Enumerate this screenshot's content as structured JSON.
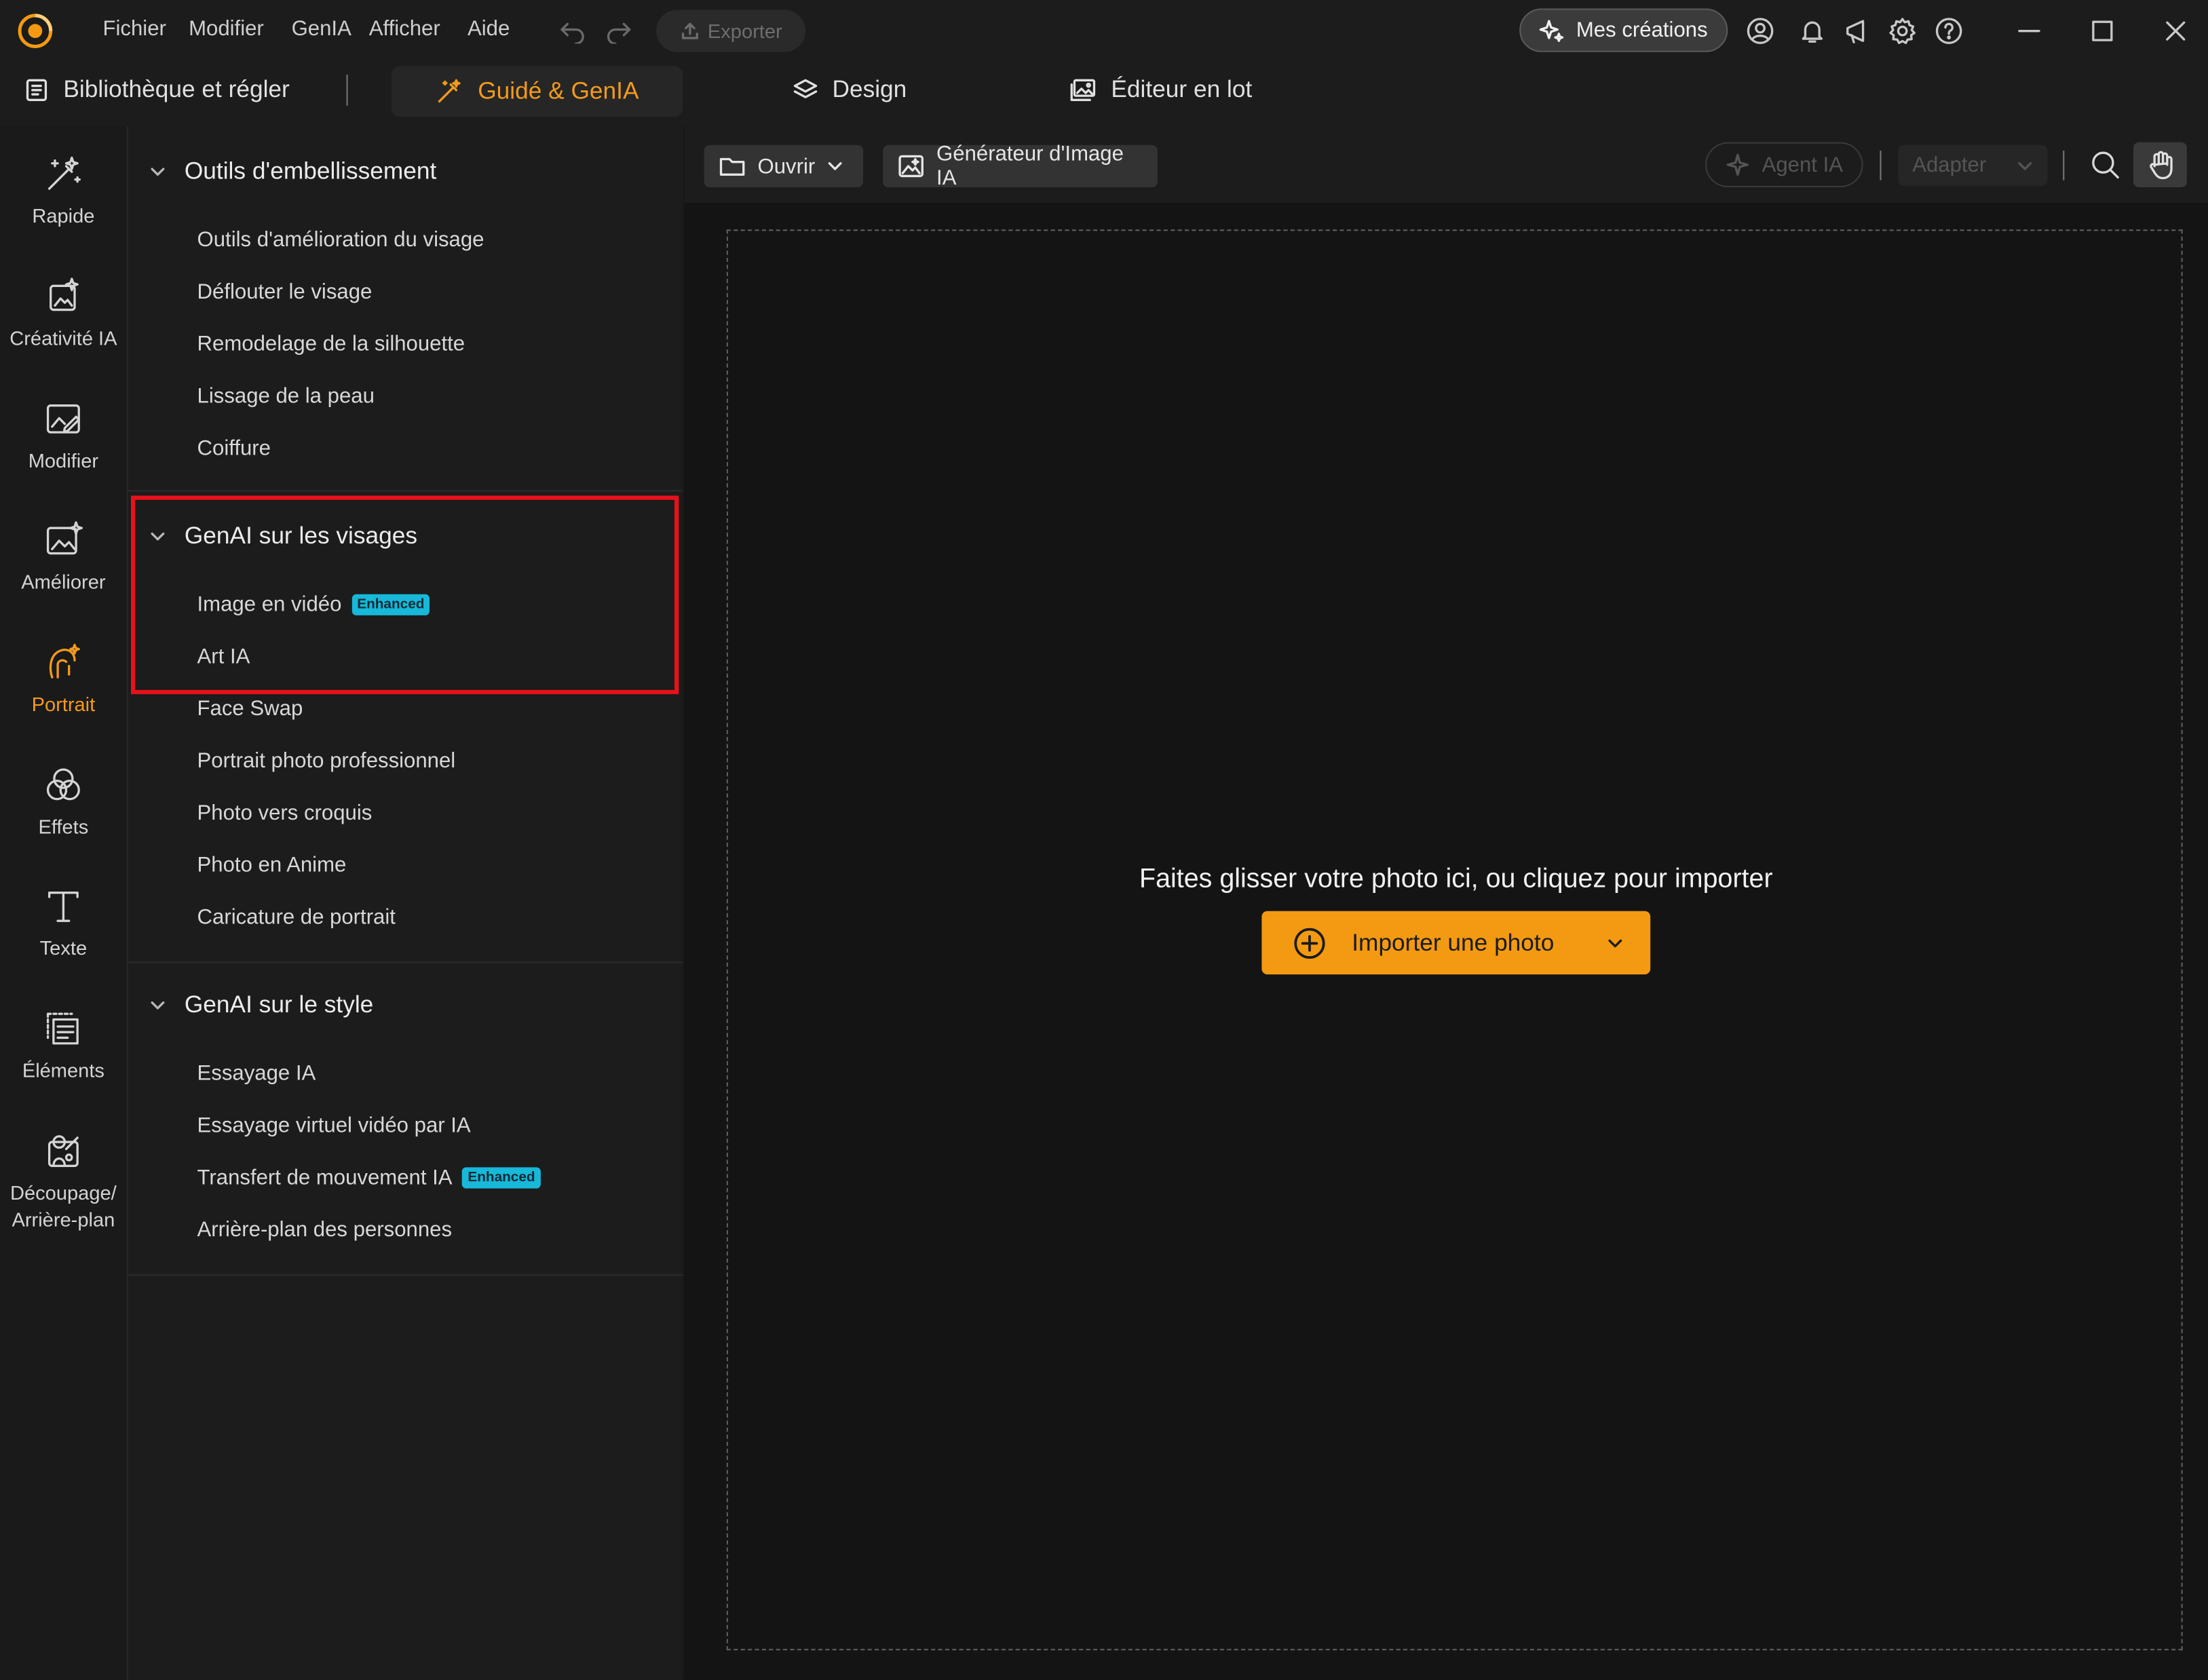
{
  "menu": {
    "items": [
      "Fichier",
      "Modifier",
      "GenIA",
      "Afficher",
      "Aide"
    ],
    "export_label": "Exporter",
    "mes_creations_label": "Mes créations"
  },
  "tabs": {
    "library": "Bibliothèque et régler",
    "guide": "Guidé & GenIA",
    "design": "Design",
    "batch": "Éditeur en lot"
  },
  "rail": {
    "items": [
      {
        "label": "Rapide",
        "icon": "magic-wand-icon"
      },
      {
        "label": "Créativité IA",
        "icon": "ai-creativity-icon"
      },
      {
        "label": "Modifier",
        "icon": "edit-image-icon"
      },
      {
        "label": "Améliorer",
        "icon": "enhance-image-icon"
      },
      {
        "label": "Portrait",
        "icon": "portrait-icon",
        "active": true
      },
      {
        "label": "Effets",
        "icon": "effects-icon"
      },
      {
        "label": "Texte",
        "icon": "text-icon"
      },
      {
        "label": "Éléments",
        "icon": "elements-icon"
      },
      {
        "label_line1": "Découpage/",
        "label_line2": "Arrière-plan",
        "icon": "cutout-icon"
      }
    ]
  },
  "panel": {
    "sections": [
      {
        "title": "Outils d'embellissement",
        "items": [
          "Outils d'amélioration du visage",
          "Déflouter le visage",
          "Remodelage de la silhouette",
          "Lissage de la peau",
          "Coiffure"
        ]
      },
      {
        "title": "GenAI sur les visages",
        "items": [
          {
            "label": "Image en vidéo",
            "badge": "Enhanced"
          },
          {
            "label": "Art IA"
          },
          {
            "label": "Face Swap"
          },
          {
            "label": "Portrait photo professionnel"
          },
          {
            "label": "Photo vers croquis"
          },
          {
            "label": "Photo en Anime"
          },
          {
            "label": "Caricature de portrait"
          }
        ]
      },
      {
        "title": "GenAI sur le style",
        "items": [
          {
            "label": "Essayage IA"
          },
          {
            "label": "Essayage virtuel vidéo par IA"
          },
          {
            "label": "Transfert de mouvement IA",
            "badge": "Enhanced"
          },
          {
            "label": "Arrière-plan des personnes"
          }
        ]
      }
    ]
  },
  "toolbar": {
    "open_label": "Ouvrir",
    "generator_label": "Générateur d'Image IA",
    "agent_label": "Agent IA",
    "adapter_label": "Adapter"
  },
  "canvas": {
    "drop_text": "Faites glisser votre photo ici, ou cliquez pour importer",
    "import_label": "Importer une photo"
  },
  "colors": {
    "accent": "#f39a12",
    "highlight": "#e8111b",
    "badge": "#17b8d8"
  }
}
